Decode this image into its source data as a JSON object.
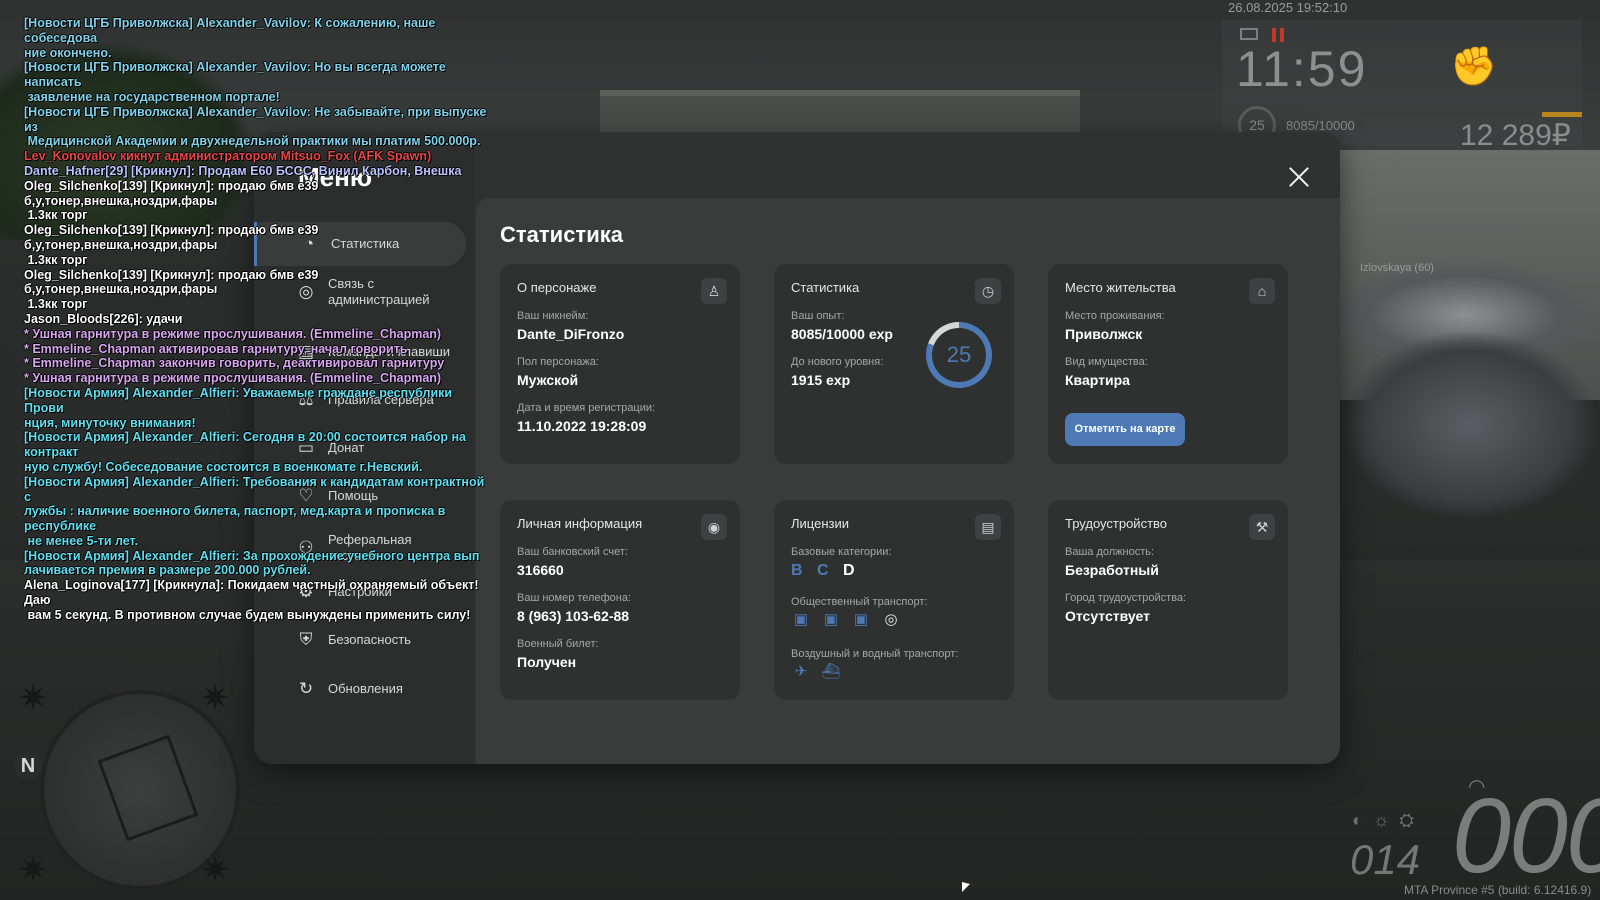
{
  "hud": {
    "datetime": "26.08.2025 19:52:10",
    "time": "11:59",
    "level": "25",
    "exp": "8085/10000",
    "money": "12 289₽",
    "server_location": "Izlovskaya (60)",
    "speed": "000",
    "fuel": "014",
    "build": "MTA Province #5 (build: 6.12416.9)",
    "minimap_north": "N",
    "colors": {
      "pause": "#c0392b",
      "bar": "#b9841f"
    }
  },
  "chat": [
    {
      "text": "[Новости ЦГБ Приволжска] Alexander_Vavilov: К сожалению, наше собеседова\nние окончено.",
      "color": "#7fd3ea"
    },
    {
      "text": "[Новости ЦГБ Приволжска] Alexander_Vavilov: Но вы всегда можете написать\n заявление на государственном портале!",
      "color": "#7fd3ea"
    },
    {
      "text": "[Новости ЦГБ Приволжска] Alexander_Vavilov: Не забывайте, при выпуске из\n Медицинской Академии и двухнедельной практики мы платим 500.000р.",
      "color": "#7fd3ea"
    },
    {
      "text": "Lev_Konovalov кикнут администратором Mitsuo_Fox (AFK Spawn)",
      "color": "#e84545"
    },
    {
      "text": "Dante_Hafner[29] [Крикнул]: Продам Е60 БССС, Винил Карбон, Внешка",
      "color": "#b9c4ff"
    },
    {
      "text": "Oleg_Silchenko[139] [Крикнул]: продаю бмв е39 б,у,тонер,внешка,ноздри,фары\n 1.3кк торг",
      "color": "#ffffff"
    },
    {
      "text": "Oleg_Silchenko[139] [Крикнул]: продаю бмв е39 б,у,тонер,внешка,ноздри,фары\n 1.3кк торг",
      "color": "#ffffff"
    },
    {
      "text": "Oleg_Silchenko[139] [Крикнул]: продаю бмв е39 б,у,тонер,внешка,ноздри,фары\n 1.3кк торг",
      "color": "#ffffff"
    },
    {
      "text": "Jason_Bloods[226]: удачи",
      "color": "#ffffff"
    },
    {
      "text": "* Ушная гарнитура в режиме прослушивания. (Emmeline_Chapman)",
      "color": "#d8a6f0"
    },
    {
      "text": "* Emmeline_Chapman активировав гарнитуру, начал говорить",
      "color": "#d8a6f0"
    },
    {
      "text": "* Emmeline_Chapman закончив говорить, деактивировал гарнитуру",
      "color": "#d8a6f0"
    },
    {
      "text": "* Ушная гарнитура в режиме прослушивания. (Emmeline_Chapman)",
      "color": "#d8a6f0"
    },
    {
      "text": "[Новости Армия] Alexander_Alfieri: Уважаемые граждане республики Прови\nнция, минуточку внимания!",
      "color": "#5fe0f0"
    },
    {
      "text": "[Новости Армия] Alexander_Alfieri: Сегодня в 20:00 состоится набор на контракт\nную службу! Собеседование состоится в военкомате г.Невский.",
      "color": "#5fe0f0"
    },
    {
      "text": "[Новости Армия] Alexander_Alfieri: Требования к кандидатам контрактной с\nлужбы : наличие военного билета, паспорт, мед.карта и прописка в республике\n не менее 5-ти лет.",
      "color": "#5fe0f0"
    },
    {
      "text": "[Новости Армия] Alexander_Alfieri: За прохождение учебного центра вып\nлачивается премия в размере 200.000 рублей.",
      "color": "#5fe0f0"
    },
    {
      "text": "Alena_Loginova[177] [Крикнула]: Покидаем частный охраняемый объект! Даю\n вам 5 секунд. В противном случае будем вынуждены применить силу!",
      "color": "#ffffff"
    }
  ],
  "menu": {
    "title": "Меню",
    "nav": [
      {
        "label": "Статистика",
        "icon": "stats-icon",
        "glyph": "◔"
      },
      {
        "label": "Связь с\nадминистрацией",
        "icon": "chat-icon",
        "glyph": "◎"
      },
      {
        "label": "Команды и клавиши",
        "icon": "keyboard-icon",
        "glyph": "▤"
      },
      {
        "label": "Правила сервера",
        "icon": "rules-icon",
        "glyph": "⚖"
      },
      {
        "label": "Донат",
        "icon": "wallet-icon",
        "glyph": "▭"
      },
      {
        "label": "Помощь",
        "icon": "heart-hands-icon",
        "glyph": "♡"
      },
      {
        "label": "Реферальная\nсистема",
        "icon": "referral-icon",
        "glyph": "⚇"
      },
      {
        "label": "Настройки",
        "icon": "gear-icon",
        "glyph": "⚙"
      },
      {
        "label": "Безопасность",
        "icon": "shield-icon",
        "glyph": "⛨"
      },
      {
        "label": "Обновления",
        "icon": "refresh-icon",
        "glyph": "↻"
      }
    ]
  },
  "stats": {
    "title": "Статистика",
    "character": {
      "title": "О персонаже",
      "nickname_label": "Ваш никнейм:",
      "nickname": "Dante_DiFronzo",
      "gender_label": "Пол персонажа:",
      "gender": "Мужской",
      "reg_label": "Дата и время регистрации:",
      "reg_date": "11.10.2022 19:28:09"
    },
    "statistics": {
      "title": "Статистика",
      "exp_label": "Ваш опыт:",
      "exp": "8085/10000 exp",
      "next_label": "До нового уровня:",
      "next": "1915 exp",
      "level": "25",
      "progress": 0.8085
    },
    "residence": {
      "title": "Место жительства",
      "place_label": "Место проживания:",
      "place": "Приволжск",
      "property_label": "Вид имущества:",
      "property": "Квартира",
      "button": "Отметить на карте"
    },
    "personal": {
      "title": "Личная информация",
      "bank_label": "Ваш банковский счет:",
      "bank": "316660",
      "phone_label": "Ваш номер телефона:",
      "phone": "8 (963) 103-62-88",
      "military_label": "Военный билет:",
      "military": "Получен"
    },
    "licenses": {
      "title": "Лицензии",
      "base_label": "Базовые категории:",
      "categories": [
        "B",
        "C",
        "D"
      ],
      "public_label": "Общественный транспорт:",
      "air_label": "Воздушный и водный транспорт:"
    },
    "employment": {
      "title": "Трудоустройство",
      "position_label": "Ваша должность:",
      "position": "Безработный",
      "city_label": "Город трудоустройства:",
      "city": "Отсутствует"
    },
    "colors": {
      "accent": "#4d7ab5"
    }
  }
}
